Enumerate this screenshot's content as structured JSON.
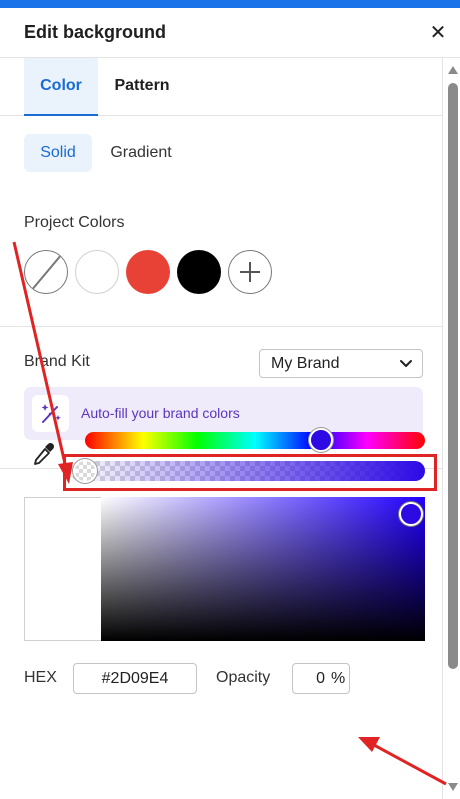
{
  "panel": {
    "title": "Edit background",
    "close_icon": "close-icon",
    "accent_color": "#1a73e8"
  },
  "tabs": [
    {
      "label": "Color",
      "active": true
    },
    {
      "label": "Pattern",
      "active": false
    }
  ],
  "fill_type": [
    {
      "label": "Solid",
      "active": true
    },
    {
      "label": "Gradient",
      "active": false
    }
  ],
  "project_colors": {
    "label": "Project Colors",
    "swatches": [
      {
        "name": "no-color",
        "icon": "no-color-slash-icon"
      },
      {
        "name": "white",
        "color": "#ffffff"
      },
      {
        "name": "red",
        "color": "#e84237"
      },
      {
        "name": "black",
        "color": "#000000"
      },
      {
        "name": "add",
        "icon": "plus-icon"
      }
    ]
  },
  "brand_kit": {
    "label": "Brand Kit",
    "selected": "My Brand",
    "autofill_label": "Auto-fill your brand colors",
    "autofill_icon": "magic-wand-icon"
  },
  "picker": {
    "eyedropper_icon": "eyedropper-icon",
    "hue_fraction": 0.69,
    "alpha_fraction": 0.0,
    "selected_color": "#2D09E4",
    "saturation_fraction": 0.96,
    "value_fraction": 0.89
  },
  "fields": {
    "hex_label": "HEX",
    "hex_value": "#2D09E4",
    "opacity_label": "Opacity",
    "opacity_value": "0",
    "opacity_unit": "%"
  },
  "annotation": {
    "highlight_color": "#e02424"
  }
}
